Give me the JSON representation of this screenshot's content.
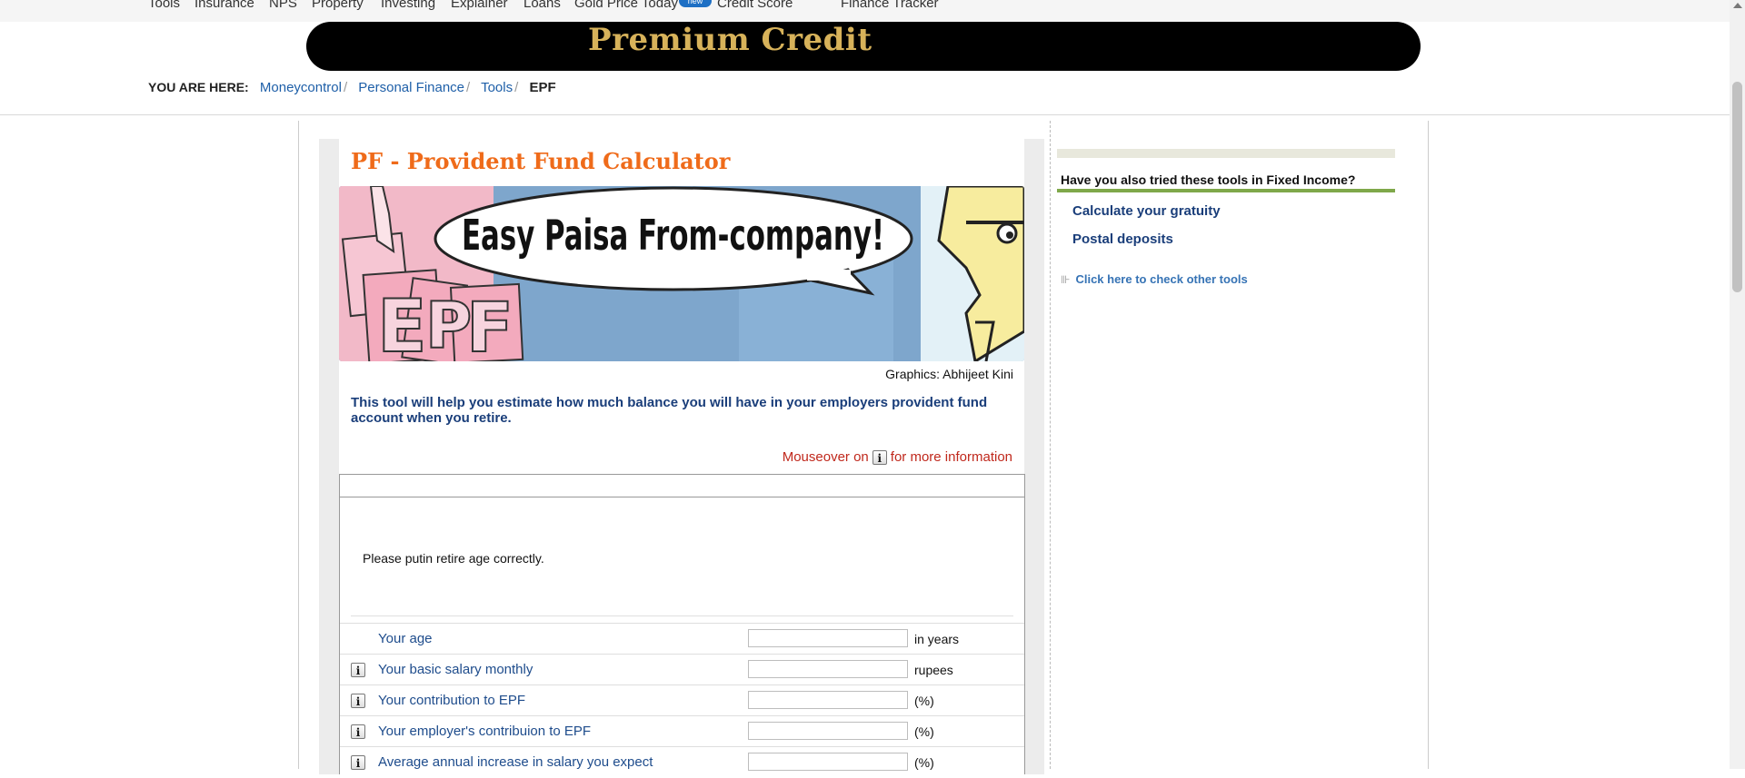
{
  "topnav": {
    "items": [
      "Tools",
      "Insurance",
      "NPS",
      "Property",
      "Investing",
      "Explainer",
      "Loans",
      "Gold Price Today",
      "Credit Score",
      "Finance Tracker"
    ],
    "new_badge": "new"
  },
  "banner": {
    "title": "Premium Credit"
  },
  "breadcrumb": {
    "label": "YOU ARE HERE:",
    "links": [
      "Moneycontrol",
      "Personal Finance",
      "Tools"
    ],
    "separator": "/",
    "current": "EPF"
  },
  "calculator": {
    "title": "PF - Provident Fund Calculator",
    "hero": {
      "speech": "Easy Paisa From-company!",
      "sign_letters": [
        "E",
        "P",
        "F"
      ]
    },
    "credit": "Graphics: Abhijeet Kini",
    "intro": "This tool will help you estimate how much balance you will have in your employers provident fund account when you retire.",
    "mouseover_before": "Mouseover on",
    "mouseover_after": "for more information",
    "info_glyph": "i",
    "message": "Please putin retire age correctly.",
    "rows": [
      {
        "label": "Your age",
        "unit": "in years",
        "value": "",
        "has_info": false
      },
      {
        "label": "Your basic salary monthly",
        "unit": "rupees",
        "value": "",
        "has_info": true
      },
      {
        "label": "Your contribution to EPF",
        "unit": "(%)",
        "value": "",
        "has_info": true
      },
      {
        "label": "Your employer's contribuion to EPF",
        "unit": "(%)",
        "value": "",
        "has_info": true
      },
      {
        "label": "Average annual increase in salary you expect",
        "unit": "(%)",
        "value": "",
        "has_info": true
      }
    ]
  },
  "sidebar": {
    "heading": "Have you also tried these tools in Fixed Income?",
    "links": [
      "Calculate your gratuity",
      "Postal deposits"
    ],
    "other_bullet": "⊪",
    "other_tools": "Click here to check other tools"
  },
  "colors": {
    "title_orange": "#ef6b1a",
    "link_blue": "#1e5fa8",
    "intro_navy": "#1a3e7a",
    "alert_red": "#c0281c",
    "sidebar_green": "#7fa84a",
    "banner_gold": "#d7b25a"
  }
}
